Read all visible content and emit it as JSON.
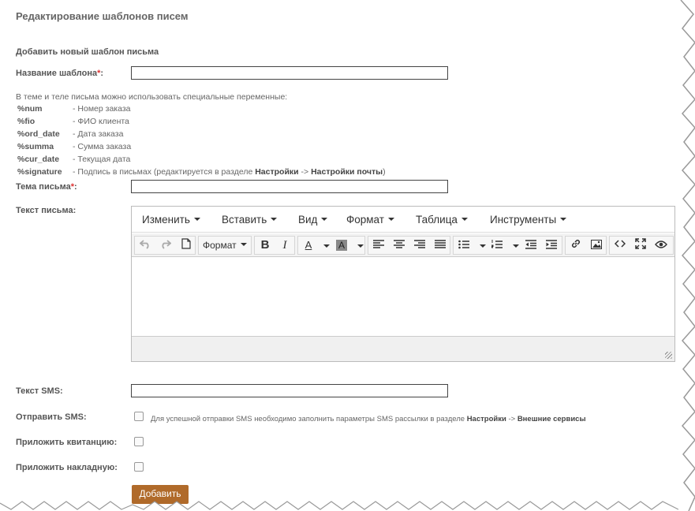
{
  "page_title": "Редактирование шаблонов писем",
  "subtitle": "Добавить новый шаблон письма",
  "fields": {
    "template_name_label": "Название шаблона",
    "subject_label": "Тема письма",
    "body_label": "Текст письма:",
    "sms_text_label": "Текст SMS:",
    "send_sms_label": "Отправить SMS:",
    "attach_receipt_label": "Приложить квитанцию:",
    "attach_waybill_label": "Приложить накладную:",
    "required_mark": "*",
    "colon": ":"
  },
  "variables_note": "В теме и теле письма можно использовать специальные переменные:",
  "variables": [
    {
      "name": "%num",
      "desc": "- Номер заказа"
    },
    {
      "name": "%fio",
      "desc": "- ФИО клиента"
    },
    {
      "name": "%ord_date",
      "desc": "- Дата заказа"
    },
    {
      "name": "%summa",
      "desc": "- Сумма заказа"
    },
    {
      "name": "%cur_date",
      "desc": "- Текущая дата"
    }
  ],
  "signature_var": {
    "name": "%signature",
    "desc": "- Подпись в письмах (редактируется в разделе ",
    "link1": "Настройки",
    "arrow": " -> ",
    "link2": "Настройки почты",
    "tail": ")"
  },
  "editor": {
    "menus": [
      "Изменить",
      "Вставить",
      "Вид",
      "Формат",
      "Таблица",
      "Инструменты"
    ],
    "format_select": "Формат",
    "icons": [
      "undo-icon",
      "redo-icon",
      "new-document-icon",
      "bold-icon",
      "italic-icon",
      "text-color-icon",
      "background-color-icon",
      "align-left-icon",
      "align-center-icon",
      "align-right-icon",
      "align-justify-icon",
      "bullet-list-icon",
      "numbered-list-icon",
      "outdent-icon",
      "indent-icon",
      "link-icon",
      "image-icon",
      "source-code-icon",
      "fullscreen-icon",
      "preview-icon"
    ],
    "bold_glyph": "B",
    "italic_glyph": "I",
    "fontcolor_glyph": "A",
    "bgcolor_glyph": "A"
  },
  "sms_note": {
    "text": "Для успешной отправки SMS необходимо заполнить параметры SMS рассылки в разделе ",
    "link1": "Настройки",
    "arrow": " -> ",
    "link2": "Внешние сервисы"
  },
  "submit_label": "Добавить",
  "colors": {
    "accent": "#b06a2a",
    "required": "#dd3333"
  }
}
